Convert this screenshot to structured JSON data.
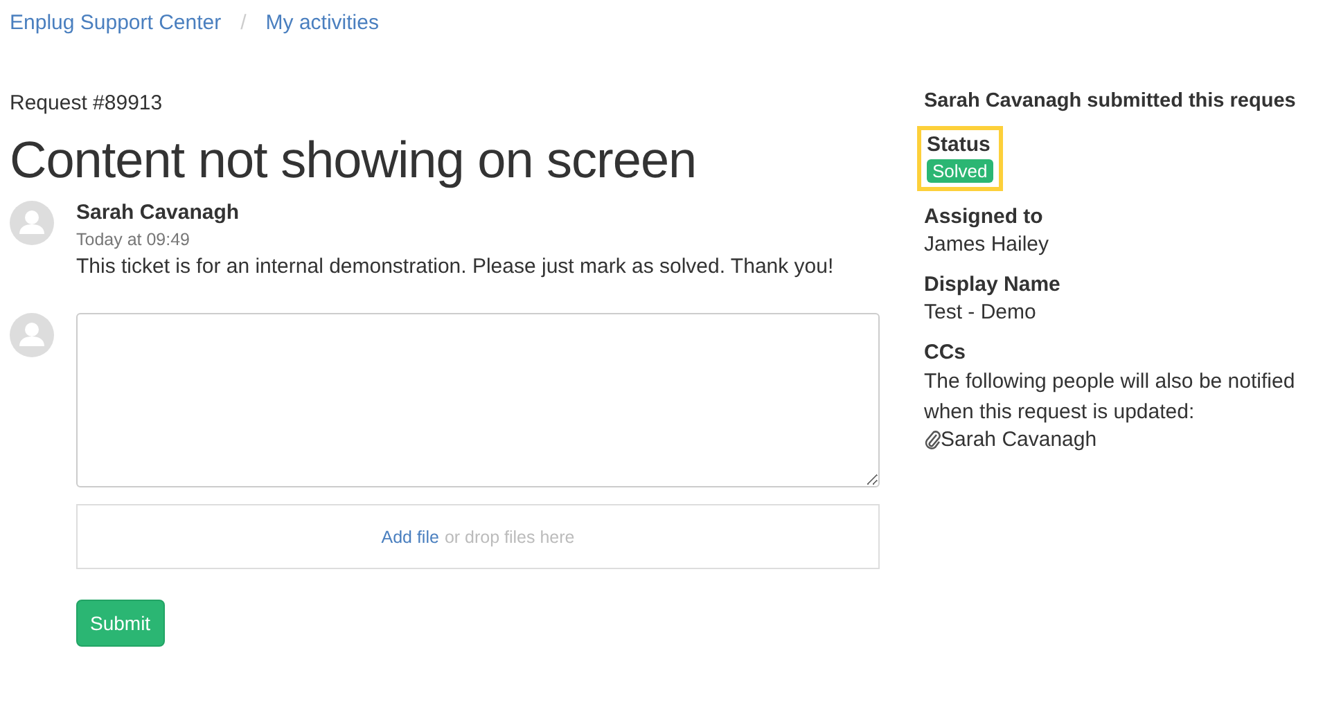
{
  "breadcrumbs": [
    {
      "label": "Enplug Support Center"
    },
    {
      "label": "My activities"
    }
  ],
  "breadcrumb_separator": "/",
  "request": {
    "number": "Request #89913",
    "title": "Content not showing on screen"
  },
  "comment": {
    "author": "Sarah Cavanagh",
    "time": "Today at 09:49",
    "body": "This ticket is for an internal demonstration. Please just mark as solved. Thank you!"
  },
  "reply": {
    "upload_link": "Add file",
    "upload_hint": "or drop files here",
    "submit": "Submit"
  },
  "sidebar": {
    "submitted_by": "Sarah Cavanagh submitted this reques",
    "status": {
      "label": "Status",
      "value": "Solved",
      "highlighted": true
    },
    "fields": [
      {
        "label": "Assigned to",
        "value": "James Hailey"
      },
      {
        "label": "Display Name",
        "value": "Test - Demo"
      }
    ],
    "ccs": {
      "label": "CCs",
      "note": "The following people will also be notified when this request is updated:",
      "people": [
        {
          "name": "Sarah Cavanagh"
        }
      ]
    }
  }
}
